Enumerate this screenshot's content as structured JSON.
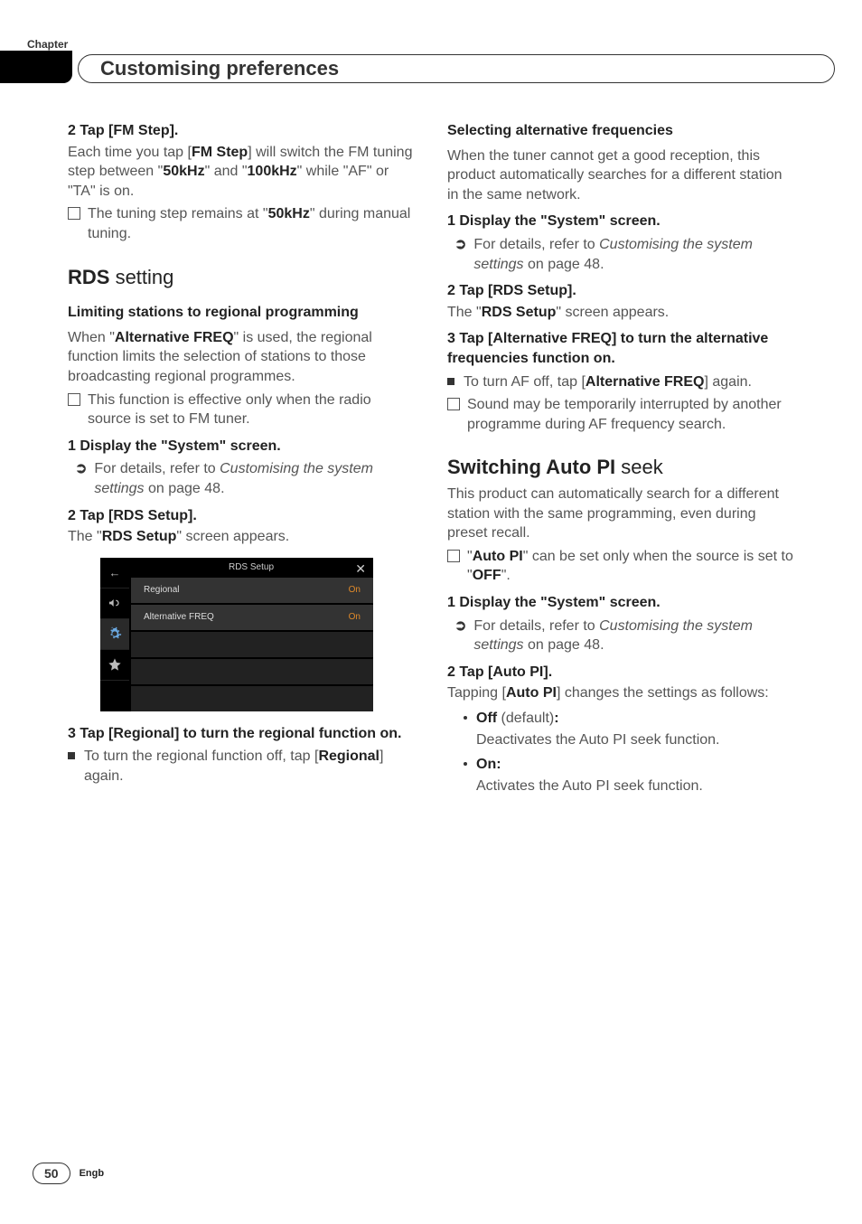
{
  "header": {
    "chapter_label": "Chapter",
    "title": "Customising preferences"
  },
  "footer": {
    "page_number": "50",
    "lang": "Engb"
  },
  "left": {
    "fm_step": {
      "step2_head": "2   Tap [FM Step].",
      "line1_pre": "Each time you tap [",
      "line1_b1": "FM Step",
      "line1_mid": "] will switch the FM tuning step between \"",
      "line1_b2": "50kHz",
      "line1_post": "\" and \"",
      "line1_b3": "100kHz",
      "line1_end": "\" while \"AF\" or \"TA\" is on.",
      "note1_pre": "The tuning step remains at \"",
      "note1_b": "50kHz",
      "note1_post": "\" during manual tuning."
    },
    "rds_heading_a": "RDS",
    "rds_heading_b": " setting",
    "limiting_h3": "Limiting stations to regional programming",
    "limiting_p_pre": "When \"",
    "limiting_p_b": "Alternative FREQ",
    "limiting_p_post": "\" is used, the regional function limits the selection of stations to those broadcasting regional programmes.",
    "limiting_note": "This function is effective only when the radio source is set to FM tuner.",
    "step1_head": "1   Display the \"System\" screen.",
    "ref_text_pre": "For details, refer to ",
    "ref_text_em": "Customising the system settings",
    "ref_text_post": " on page 48.",
    "step2b_head": "2   Tap [RDS Setup].",
    "rds_appears_pre": "The \"",
    "rds_appears_b": "RDS Setup",
    "rds_appears_post": "\" screen appears.",
    "step3_head": "3   Tap [Regional] to turn the regional function on.",
    "turn_off_pre": "To turn the regional function off, tap [",
    "turn_off_b": "Regional",
    "turn_off_post": "] again."
  },
  "ss": {
    "title": "RDS Setup",
    "close": "✕",
    "back": "←",
    "row1_label": "Regional",
    "row1_val": "On",
    "row2_label": "Alternative FREQ",
    "row2_val": "On"
  },
  "right": {
    "sel_h3": "Selecting alternative frequencies",
    "sel_p": "When the tuner cannot get a good reception, this product automatically searches for a different station in the same network.",
    "step1_head": "1   Display the \"System\" screen.",
    "ref_text_pre": "For details, refer to ",
    "ref_text_em": "Customising the system settings",
    "ref_text_post": " on page 48.",
    "step2_head": "2   Tap [RDS Setup].",
    "rds_appears_pre": "The \"",
    "rds_appears_b": "RDS Setup",
    "rds_appears_post": "\" screen appears.",
    "step3_head": "3   Tap [Alternative FREQ] to turn the alternative frequencies function on.",
    "af_off_pre": "To turn AF off, tap [",
    "af_off_b": "Alternative FREQ",
    "af_off_post": "] again.",
    "af_note": "Sound may be temporarily interrupted by another programme during AF frequency search.",
    "autopi_h2_a": "Switching Auto PI",
    "autopi_h2_b": " seek",
    "autopi_p": "This product can automatically search for a different station with the same programming, even during preset recall.",
    "autopi_note_pre": "\"",
    "autopi_note_b": "Auto PI",
    "autopi_note_mid": "\" can be set only when the source is set to \"",
    "autopi_note_b2": "OFF",
    "autopi_note_post": "\".",
    "autopi_step1": "1   Display the \"System\" screen.",
    "autopi_step2": "2   Tap [Auto PI].",
    "autopi_tap_pre": "Tapping [",
    "autopi_tap_b": "Auto PI",
    "autopi_tap_post": "] changes the settings as follows:",
    "off_label": "Off",
    "off_default": " (default)",
    "off_colon": ":",
    "off_desc": "Deactivates the Auto PI seek function.",
    "on_label": "On:",
    "on_desc": "Activates the Auto PI seek function."
  }
}
